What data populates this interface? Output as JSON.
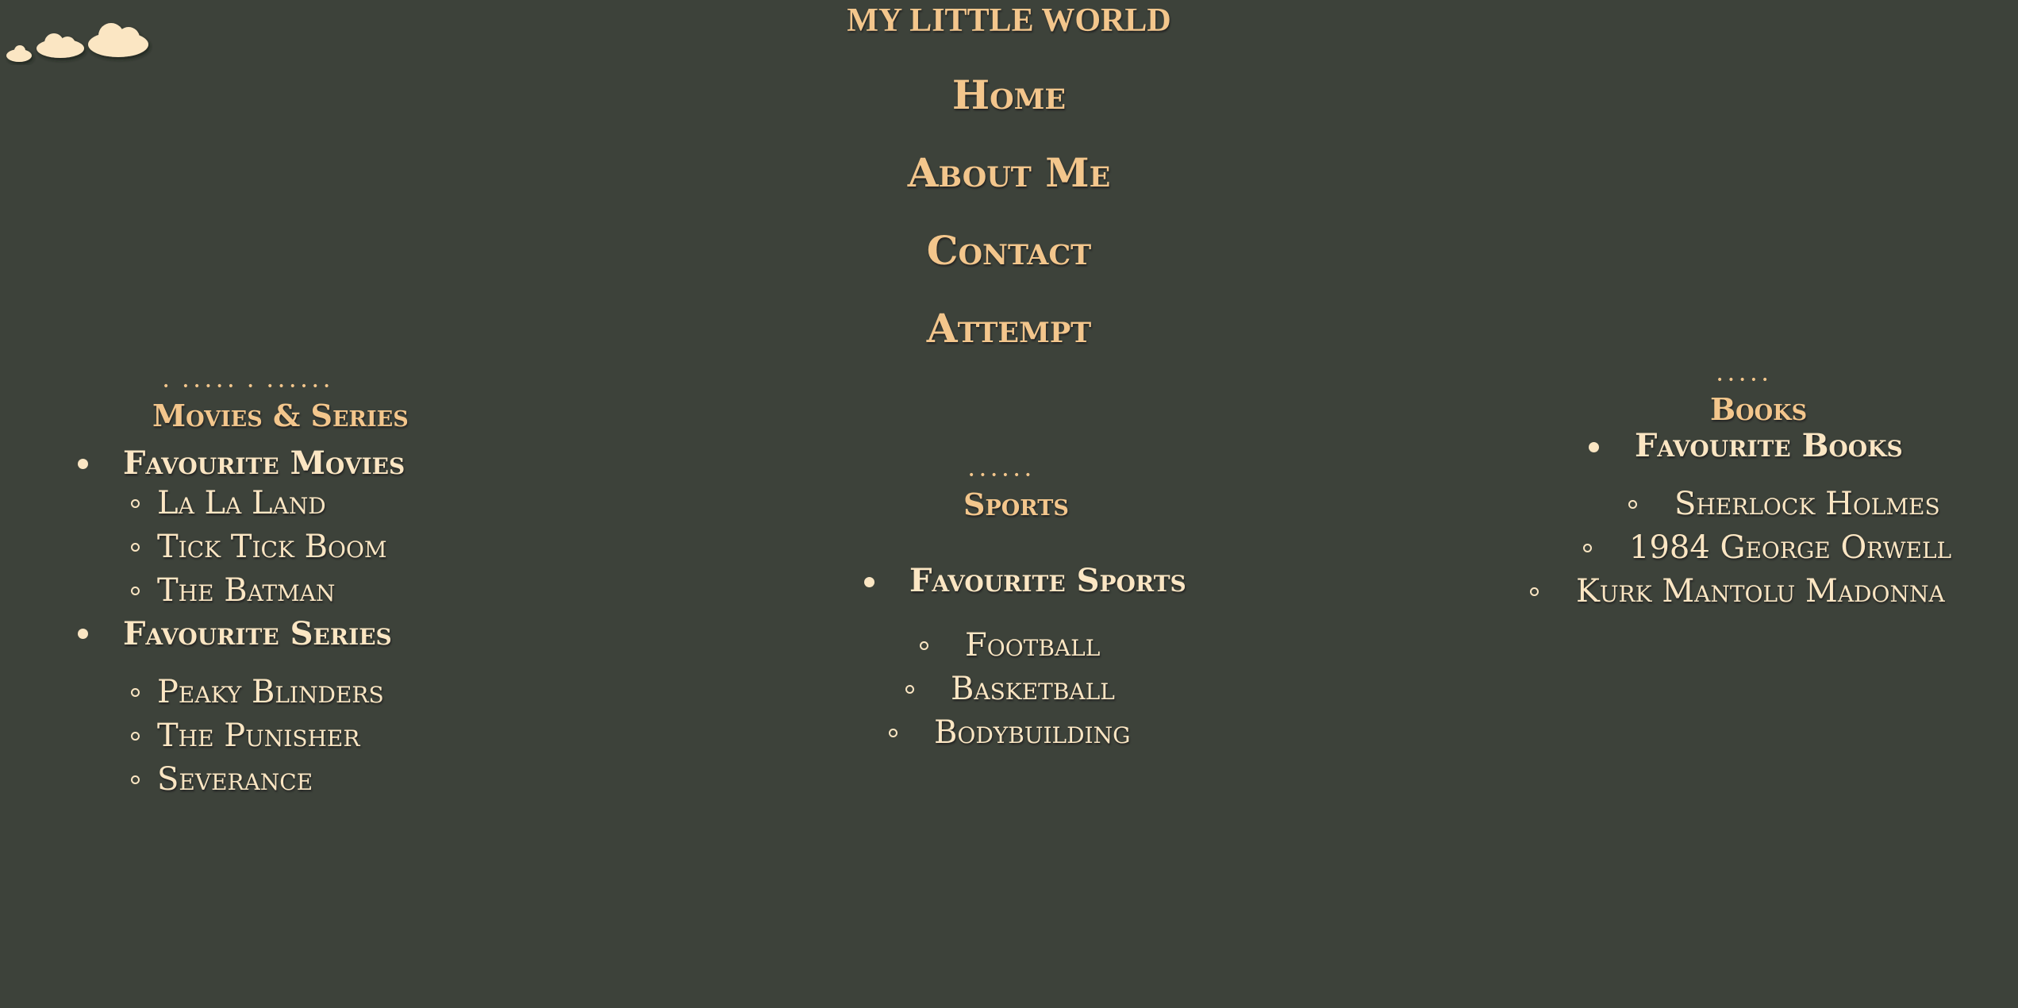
{
  "header": {
    "title": "MY LITTLE WORLD",
    "logo_icon": "clouds-icon"
  },
  "nav": {
    "items": [
      {
        "label": "Home"
      },
      {
        "label": "About Me"
      },
      {
        "label": "Contact"
      },
      {
        "label": "Attempt"
      }
    ]
  },
  "sections": {
    "movies": {
      "dots": "• ••••• • ••••••",
      "title": "Movies & Series",
      "groups": [
        {
          "label": "Favourite Movies",
          "items": [
            "La La Land",
            "Tick Tick Boom",
            "The Batman"
          ]
        },
        {
          "label": "Favourite Series",
          "items": [
            "Peaky Blinders",
            "The Punisher",
            "Severance"
          ]
        }
      ]
    },
    "sports": {
      "dots": "••••••",
      "title": "Sports",
      "groups": [
        {
          "label": "Favourite Sports",
          "items": [
            "Football",
            "Basketball",
            "Bodybuilding"
          ]
        }
      ]
    },
    "books": {
      "dots": "•••••",
      "title": "Books",
      "groups": [
        {
          "label": "Favourite Books",
          "items": [
            "Sherlock Holmes",
            "1984 George Orwell",
            "Kurk Mantolu Madonna"
          ]
        }
      ]
    }
  },
  "colors": {
    "background": "#3d423a",
    "accent": "#f3c68c",
    "text": "#fbe6c3"
  }
}
